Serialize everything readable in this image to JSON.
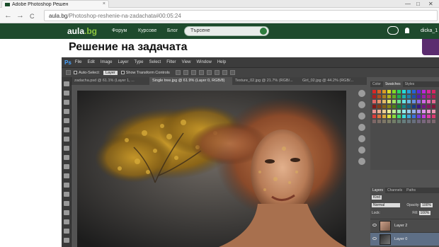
{
  "browser": {
    "tab_title": "Adobe Photoshop Решен",
    "tab_close": "×",
    "window_controls": [
      "—",
      "□",
      "✕"
    ],
    "back": "←",
    "forward": "→",
    "reload": "C",
    "url_host": "aula.bg",
    "url_path": "/Photoshop-reshenie-na-zadachata#00:05:24"
  },
  "site": {
    "logo_main": "aula",
    "logo_suffix": ".bg",
    "nav": [
      "Форум",
      "Курсове",
      "Блог"
    ],
    "search_placeholder": "Търсене",
    "user_name": "dicka_1",
    "colors": {
      "header": "#1e4a2d",
      "accent": "#8dc63f",
      "promo": "#5b2c6f"
    }
  },
  "page": {
    "title": "Решение на задачата"
  },
  "photoshop": {
    "logo": "Ps",
    "menu": [
      "File",
      "Edit",
      "Image",
      "Layer",
      "Type",
      "Select",
      "Filter",
      "View",
      "Window",
      "Help"
    ],
    "options": {
      "auto_select_label": "Auto-Select:",
      "auto_select_value": "Layer",
      "show_transform_label": "Show Transform Controls"
    },
    "doc_tabs": [
      "zadacha.psd @ 61.1% (Layer 1, ...",
      "Single tree.jpg @ 61.9% (Layer 0, RGB/8)",
      "Texture_02.jpg @ 21.7% (RGB/...",
      "Girl_02.jpg @ 44.2% (RGB/..."
    ],
    "swatch_tabs": [
      "Color",
      "Swatches",
      "Styles"
    ],
    "layers_panel": {
      "tabs": [
        "Layers",
        "Channels",
        "Paths"
      ],
      "kind_label": "Kind",
      "blend_mode": "Normal",
      "opacity_label": "Opacity:",
      "opacity_value": "100%",
      "lock_label": "Lock:",
      "fill_label": "Fill:",
      "fill_value": "100%",
      "layers": [
        "Layer 2",
        "Layer 0"
      ]
    }
  }
}
